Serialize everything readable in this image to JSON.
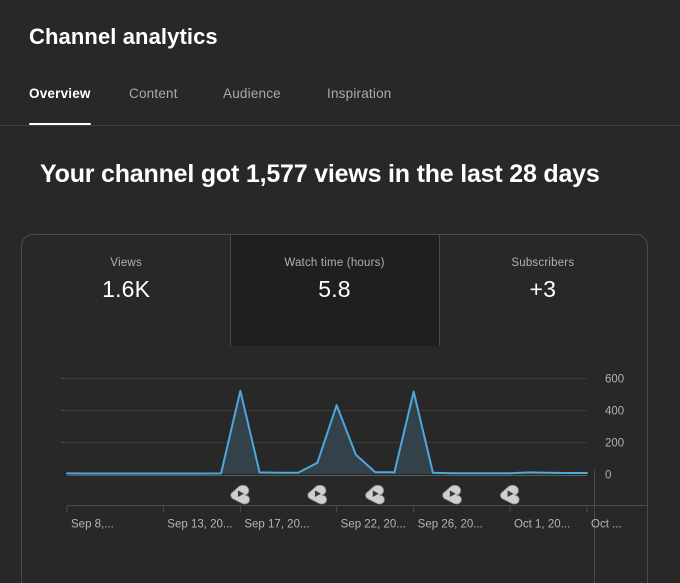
{
  "header": {
    "title": "Channel analytics"
  },
  "tabs": [
    {
      "label": "Overview",
      "active": true
    },
    {
      "label": "Content",
      "active": false
    },
    {
      "label": "Audience",
      "active": false
    },
    {
      "label": "Inspiration",
      "active": false
    }
  ],
  "headline": "Your channel got 1,577 views in the last 28 days",
  "metrics": [
    {
      "label": "Views",
      "value": "1.6K",
      "selected": false
    },
    {
      "label": "Watch time (hours)",
      "value": "5.8",
      "selected": true
    },
    {
      "label": "Subscribers",
      "value": "+3",
      "selected": false
    }
  ],
  "colors": {
    "page_background": "#282828",
    "card_border": "#4a4a4a",
    "selected_metric_background": "#1f1f1f",
    "line": "#4fa8dc",
    "area_fill": "#33414a",
    "gridline": "#3a3a3a",
    "zero_axis": "#5a5a5a",
    "muted_text": "#aaaaaa",
    "primary_text": "#ffffff"
  },
  "chart_data": {
    "type": "area",
    "title": "",
    "xlabel": "",
    "ylabel": "Views",
    "ylim": [
      0,
      700
    ],
    "yticks": [
      0,
      200,
      400,
      600
    ],
    "ytick_labels": [
      "0",
      "200",
      "400",
      "600"
    ],
    "grid": true,
    "legend_position": "none",
    "xtick_labels": [
      "Sep 8,...",
      "Sep 13, 20...",
      "Sep 17, 20...",
      "Sep 22, 20...",
      "Sep 26, 20...",
      "Oct 1, 20...",
      "Oct ..."
    ],
    "xtick_indices": [
      0,
      5,
      9,
      14,
      18,
      23,
      27
    ],
    "x": [
      "Sep 8",
      "Sep 9",
      "Sep 10",
      "Sep 11",
      "Sep 12",
      "Sep 13",
      "Sep 14",
      "Sep 15",
      "Sep 16",
      "Sep 17",
      "Sep 18",
      "Sep 19",
      "Sep 20",
      "Sep 21",
      "Sep 22",
      "Sep 23",
      "Sep 24",
      "Sep 25",
      "Sep 26",
      "Sep 27",
      "Sep 28",
      "Sep 29",
      "Sep 30",
      "Oct 1",
      "Oct 2",
      "Oct 3",
      "Oct 4",
      "Oct 5"
    ],
    "series": [
      {
        "name": "Views",
        "values": [
          4,
          3,
          3,
          3,
          3,
          3,
          3,
          3,
          4,
          520,
          10,
          8,
          8,
          70,
          430,
          120,
          12,
          10,
          515,
          8,
          5,
          5,
          5,
          5,
          10,
          8,
          6,
          6
        ]
      }
    ],
    "markers": {
      "type": "shorts-published",
      "label": "Short published",
      "x_indices": [
        9,
        13,
        16,
        20,
        23
      ]
    }
  }
}
